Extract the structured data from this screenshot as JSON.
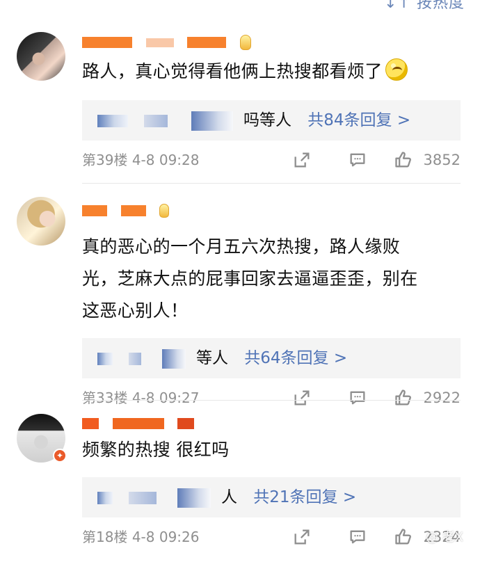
{
  "header": {
    "sort_label": "↓↑ 按热度"
  },
  "comments": [
    {
      "text": "路人，真心觉得看他俩上热搜都看烦了",
      "emoji": "smirk-face",
      "reply_users_suffix": "吗等人",
      "reply_count": "共84条回复 >",
      "floor": "第39楼",
      "date": "4-8",
      "time": "09:28",
      "likes": "3852"
    },
    {
      "text_lines": [
        "真的恶心的一个月五六次热搜，路人缘败",
        "光，芝麻大点的屁事回家去逼逼歪歪，别在",
        "这恶心别人！"
      ],
      "reply_users_suffix": "等人",
      "reply_count": "共64条回复 >",
      "floor": "第33楼",
      "date": "4-8",
      "time": "09:27",
      "likes": "2922"
    },
    {
      "text": "频繁的热搜 很红吗",
      "reply_users_suffix": "人",
      "reply_count": "共21条回复 >",
      "floor": "第18楼",
      "date": "4-8",
      "time": "09:26",
      "likes": "2324"
    }
  ],
  "colors": {
    "link_blue": "#4f73b6",
    "muted_gray": "#8f8f8f",
    "username_orange": "#f7812d",
    "reply_bg": "#f4f4f4"
  },
  "watermark": "@ 老X"
}
